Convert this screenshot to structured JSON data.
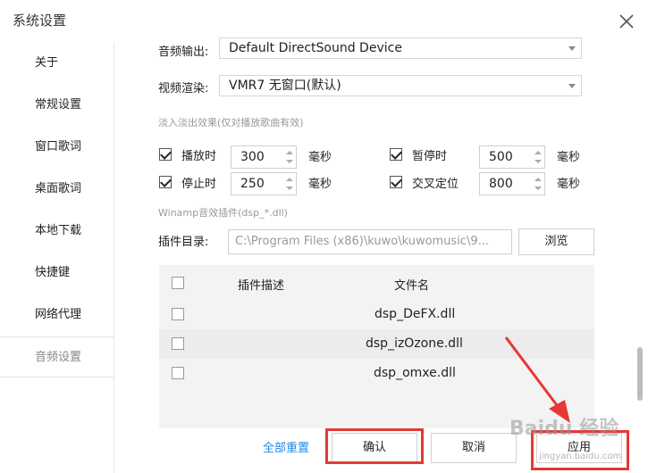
{
  "window": {
    "title": "系统设置"
  },
  "sidebar": {
    "items": [
      {
        "label": "关于"
      },
      {
        "label": "常规设置"
      },
      {
        "label": "窗口歌词"
      },
      {
        "label": "桌面歌词"
      },
      {
        "label": "本地下载"
      },
      {
        "label": "快捷键"
      },
      {
        "label": "网络代理"
      },
      {
        "label": "音频设置"
      }
    ],
    "active": "音频设置"
  },
  "audio": {
    "output_label": "音频输出:",
    "output_value": "Default DirectSound Device",
    "render_label": "视频渲染:",
    "render_value": "VMR7 无窗口(默认)"
  },
  "fade": {
    "hint": "淡入淡出效果(仅对播放歌曲有效)",
    "play_label": "播放时",
    "play_value": "300",
    "play_checked": true,
    "pause_label": "暂停时",
    "pause_value": "500",
    "pause_checked": true,
    "stop_label": "停止时",
    "stop_value": "250",
    "stop_checked": true,
    "cross_label": "交叉定位",
    "cross_value": "800",
    "cross_checked": true,
    "unit": "毫秒"
  },
  "plugin": {
    "hint": "Winamp音效插件(dsp_*.dll)",
    "dir_label": "插件目录:",
    "dir_value": "C:\\Program  Files  (x86)\\kuwo\\kuwomusic\\9...",
    "browse_label": "浏览",
    "table": {
      "headers": [
        "插件描述",
        "文件名"
      ],
      "rows": [
        {
          "desc": "",
          "file": "dsp_DeFX.dll"
        },
        {
          "desc": "",
          "file": "dsp_izOzone.dll"
        },
        {
          "desc": "",
          "file": "dsp_omxe.dll"
        }
      ]
    }
  },
  "footer": {
    "reset_label": "全部重置",
    "confirm_label": "确认",
    "cancel_label": "取消",
    "apply_label": "应用"
  },
  "overlay": {
    "watermark": "Baidu 经验",
    "watermark_url": "jingyan.baidu.com",
    "highlight_color": "#e53935"
  }
}
